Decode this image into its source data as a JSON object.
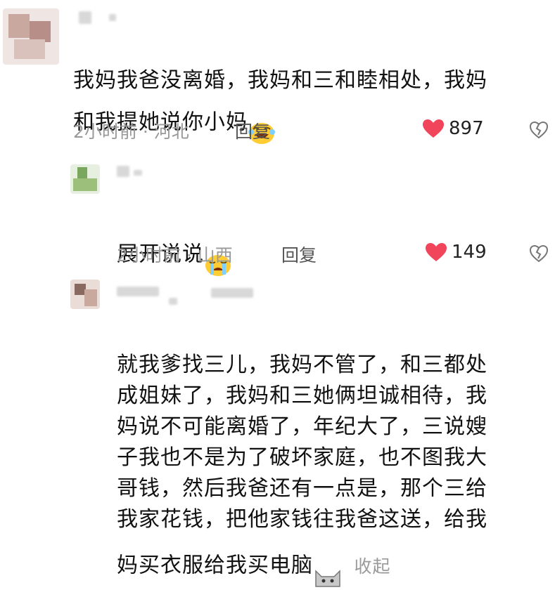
{
  "comments": [
    {
      "text": "我妈我爸没离婚，我妈和三和睦相处，我妈\n和我提她说你小妈",
      "emoji": "laughing-emoji",
      "time": "2小时前 · 河北",
      "reply_label": "回复",
      "likes": "897"
    },
    {
      "text": "展开说说",
      "emoji": "crying-emoji",
      "time": "2小时前 · 山西",
      "reply_label": "回复",
      "likes": "149"
    },
    {
      "text": "就我爹找三儿，我妈不管了，和三都处\n成姐妹了，我妈和三她俩坦诚相待，我\n妈说不可能离婚了，年纪大了，三说嫂\n子我也不是为了破坏家庭，也不图我大\n哥钱，然后我爸还有一点是，那个三给\n我家花钱，把他家钱往我爸这送，给我\n妈买衣服给我买电脑",
      "emoji": "cat-emoji",
      "collapse_label": "收起"
    }
  ],
  "colors": {
    "like_heart": "#f0455a",
    "meta": "#9a9a9a"
  }
}
